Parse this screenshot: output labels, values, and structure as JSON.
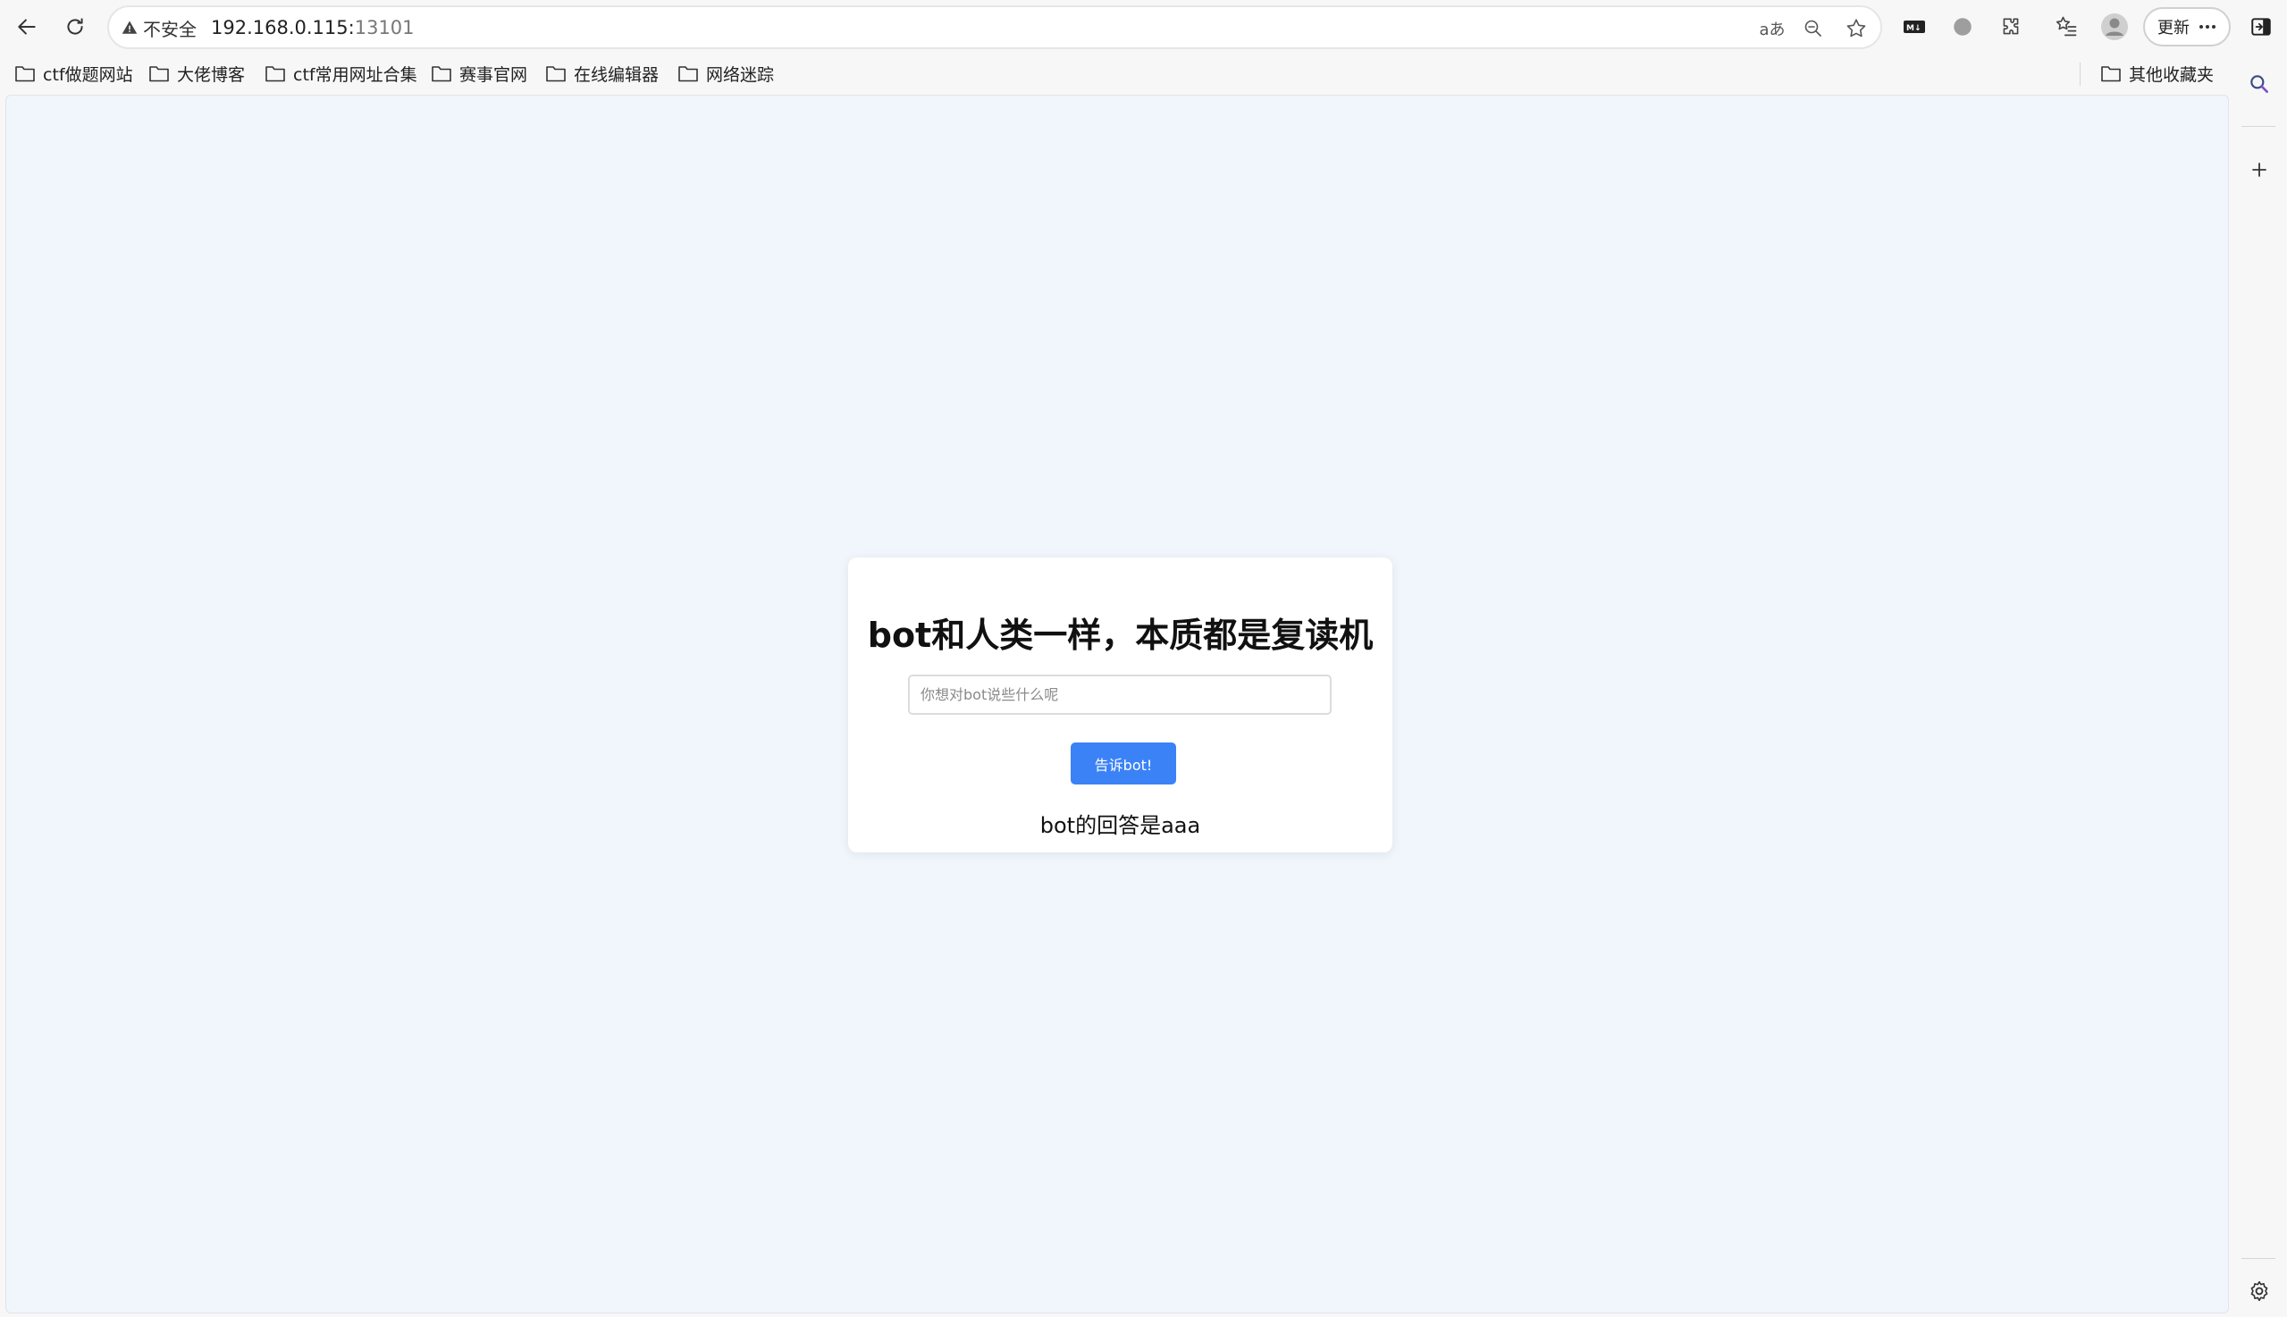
{
  "browser": {
    "security_label": "不安全",
    "url_host": "192.168.0.115:",
    "url_port": "13101",
    "translate_label": "aあ",
    "update_label": "更新"
  },
  "bookmarks": [
    {
      "label": "ctf做题网站"
    },
    {
      "label": "大佬博客"
    },
    {
      "label": "ctf常用网址合集"
    },
    {
      "label": "赛事官网"
    },
    {
      "label": "在线编辑器"
    },
    {
      "label": "网络迷踪"
    }
  ],
  "other_bookmarks": "其他收藏夹",
  "page": {
    "title": "bot和人类一样，本质都是复读机",
    "input_placeholder": "你想对bot说些什么呢",
    "input_value": "",
    "button_label": "告诉bot!",
    "answer": "bot的回答是aaa"
  },
  "colors": {
    "accent": "#3b82f6",
    "page_background": "#f1f6fd"
  }
}
